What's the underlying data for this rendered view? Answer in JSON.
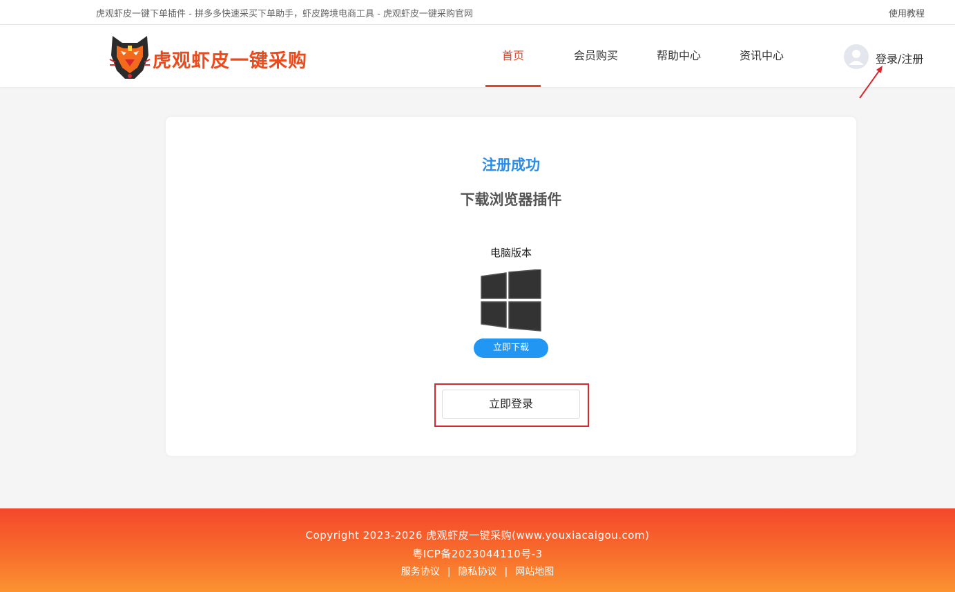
{
  "topbar": {
    "slogan": "虎观虾皮一键下单插件 - 拼多多快速采买下单助手，虾皮跨境电商工具 - 虎观虾皮一键采购官网",
    "tutorial": "使用教程"
  },
  "header": {
    "logo_text": "虎观虾皮一键采购",
    "nav": [
      {
        "label": "首页",
        "active": true
      },
      {
        "label": "会员购买",
        "active": false
      },
      {
        "label": "帮助中心",
        "active": false
      },
      {
        "label": "资讯中心",
        "active": false
      }
    ],
    "login_register": "登录/注册"
  },
  "card": {
    "success_title": "注册成功",
    "plugin_title": "下载浏览器插件",
    "pc_label": "电脑版本",
    "os_icon": "windows-icon",
    "download_button": "立即下载",
    "login_button": "立即登录"
  },
  "footer": {
    "copyright": "Copyright 2023-2026 虎观虾皮一键采购(www.youxiacaigou.com)",
    "icp": "粤ICP备2023044110号-3",
    "links": [
      "服务协议",
      "隐私协议",
      "网站地图"
    ]
  },
  "colors": {
    "accent_red": "#e0452c",
    "title_blue": "#2a8ce8",
    "button_blue": "#2196f3",
    "highlight_frame": "#d9272e",
    "footer_top": "#f4472c",
    "footer_bottom": "#fb9331"
  }
}
